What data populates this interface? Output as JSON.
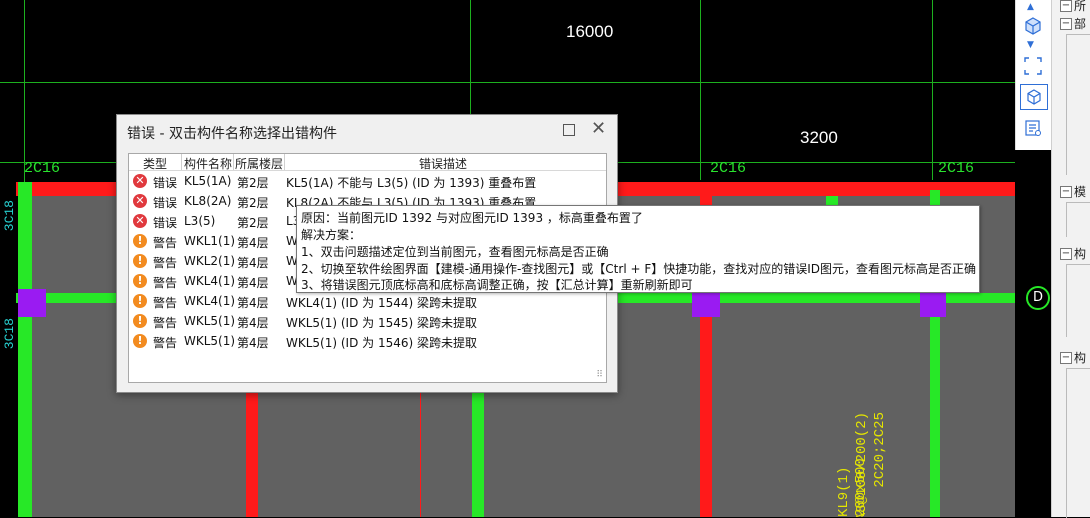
{
  "canvas": {
    "dim_top": "16000",
    "dim_mid": "3200",
    "rebar_labels": [
      "2C16",
      "2C16",
      "2C16",
      "2C16"
    ],
    "side_labels": [
      "3C18",
      "3C18"
    ],
    "beam_annotations": [
      "KL9(1) 200x500",
      "A8@100/200(2)",
      "2C20;2C25"
    ],
    "axis_badge": "D"
  },
  "toolbar": {
    "icons": [
      "cube-icon",
      "fit-view-icon",
      "box-view-icon",
      "properties-icon"
    ]
  },
  "sidepanel": {
    "items": [
      "所",
      "部",
      "模",
      "构",
      "构"
    ]
  },
  "dialog": {
    "title": "错误 - 双击构件名称选择出错构件",
    "columns": {
      "type": "类型",
      "name": "构件名称",
      "floor": "所属楼层",
      "desc": "错误描述"
    },
    "rows": [
      {
        "level": "error",
        "type": "错误",
        "name": "KL5(1A)",
        "floor": "第2层",
        "desc": "KL5(1A) 不能与 L3(5) (ID 为 1393) 重叠布置"
      },
      {
        "level": "error",
        "type": "错误",
        "name": "KL8(2A)",
        "floor": "第2层",
        "desc": "KL8(2A) 不能与 L3(5) (ID 为 1393) 重叠布置"
      },
      {
        "level": "error",
        "type": "错误",
        "name": "L3(5)",
        "floor": "第2层",
        "desc": "L3"
      },
      {
        "level": "warning",
        "type": "警告",
        "name": "WKL1(1)",
        "floor": "第4层",
        "desc": "W"
      },
      {
        "level": "warning",
        "type": "警告",
        "name": "WKL2(1)",
        "floor": "第4层",
        "desc": "W"
      },
      {
        "level": "warning",
        "type": "警告",
        "name": "WKL4(1)",
        "floor": "第4层",
        "desc": "W"
      },
      {
        "level": "warning",
        "type": "警告",
        "name": "WKL4(1)",
        "floor": "第4层",
        "desc": "WKL4(1) (ID 为 1544) 梁跨未提取"
      },
      {
        "level": "warning",
        "type": "警告",
        "name": "WKL5(1)",
        "floor": "第4层",
        "desc": "WKL5(1) (ID 为 1545) 梁跨未提取"
      },
      {
        "level": "warning",
        "type": "警告",
        "name": "WKL5(1)",
        "floor": "第4层",
        "desc": "WKL5(1) (ID 为 1546) 梁跨未提取"
      }
    ]
  },
  "tooltip": {
    "lines": [
      "原因：当前图元ID 1392 与对应图元ID 1393 ，标高重叠布置了",
      "解决方案：",
      "1、双击问题描述定位到当前图元，查看图元标高是否正确",
      "2、切换至软件绘图界面【建模-通用操作-查找图元】或【Ctrl + F】快捷功能，查找对应的错误ID图元，查看图元标高是否正确",
      "3、将错误图元顶底标高和底标高调整正确，按【汇总计算】重新刷新即可"
    ]
  }
}
